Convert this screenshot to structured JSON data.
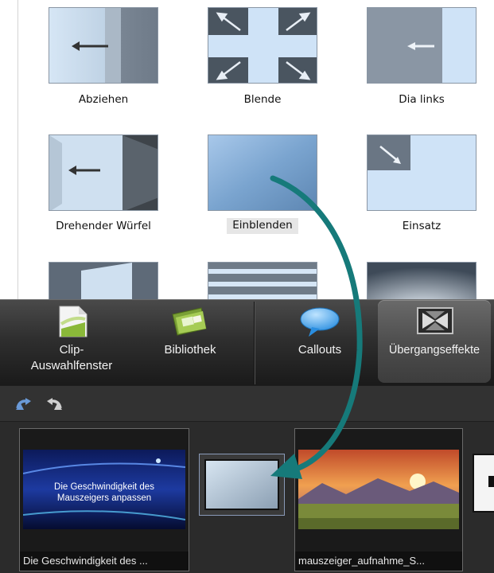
{
  "transitions": {
    "items": [
      {
        "label": "Abziehen"
      },
      {
        "label": "Blende"
      },
      {
        "label": "Dia links"
      },
      {
        "label": "Drehender Würfel"
      },
      {
        "label": "Einblenden"
      },
      {
        "label": "Einsatz"
      }
    ]
  },
  "toolbar": {
    "clip_label_line1": "Clip-",
    "clip_label_line2": "Auswahlfenster",
    "bibliothek_label": "Bibliothek",
    "callouts_label": "Callouts",
    "uebergang_label": "Übergangseffekte"
  },
  "timeline": {
    "clip1_title_line1": "Die Geschwindigkeit des",
    "clip1_title_line2": "Mauszeigers anpassen",
    "clip1_caption": "Die Geschwindigkeit des ...",
    "clip2_caption": "mauszeiger_aufnahme_S..."
  },
  "colors": {
    "arrow": "#167a7a",
    "toolbar_bg": "#2f2f2f",
    "timeline_bg": "#2b2b2b",
    "thumb_blue": "#cfe3f7"
  },
  "icons": [
    "clip-bin-icon",
    "library-icon",
    "callouts-icon",
    "transitions-icon",
    "undo-icon",
    "redo-icon",
    "arrow-icon"
  ]
}
